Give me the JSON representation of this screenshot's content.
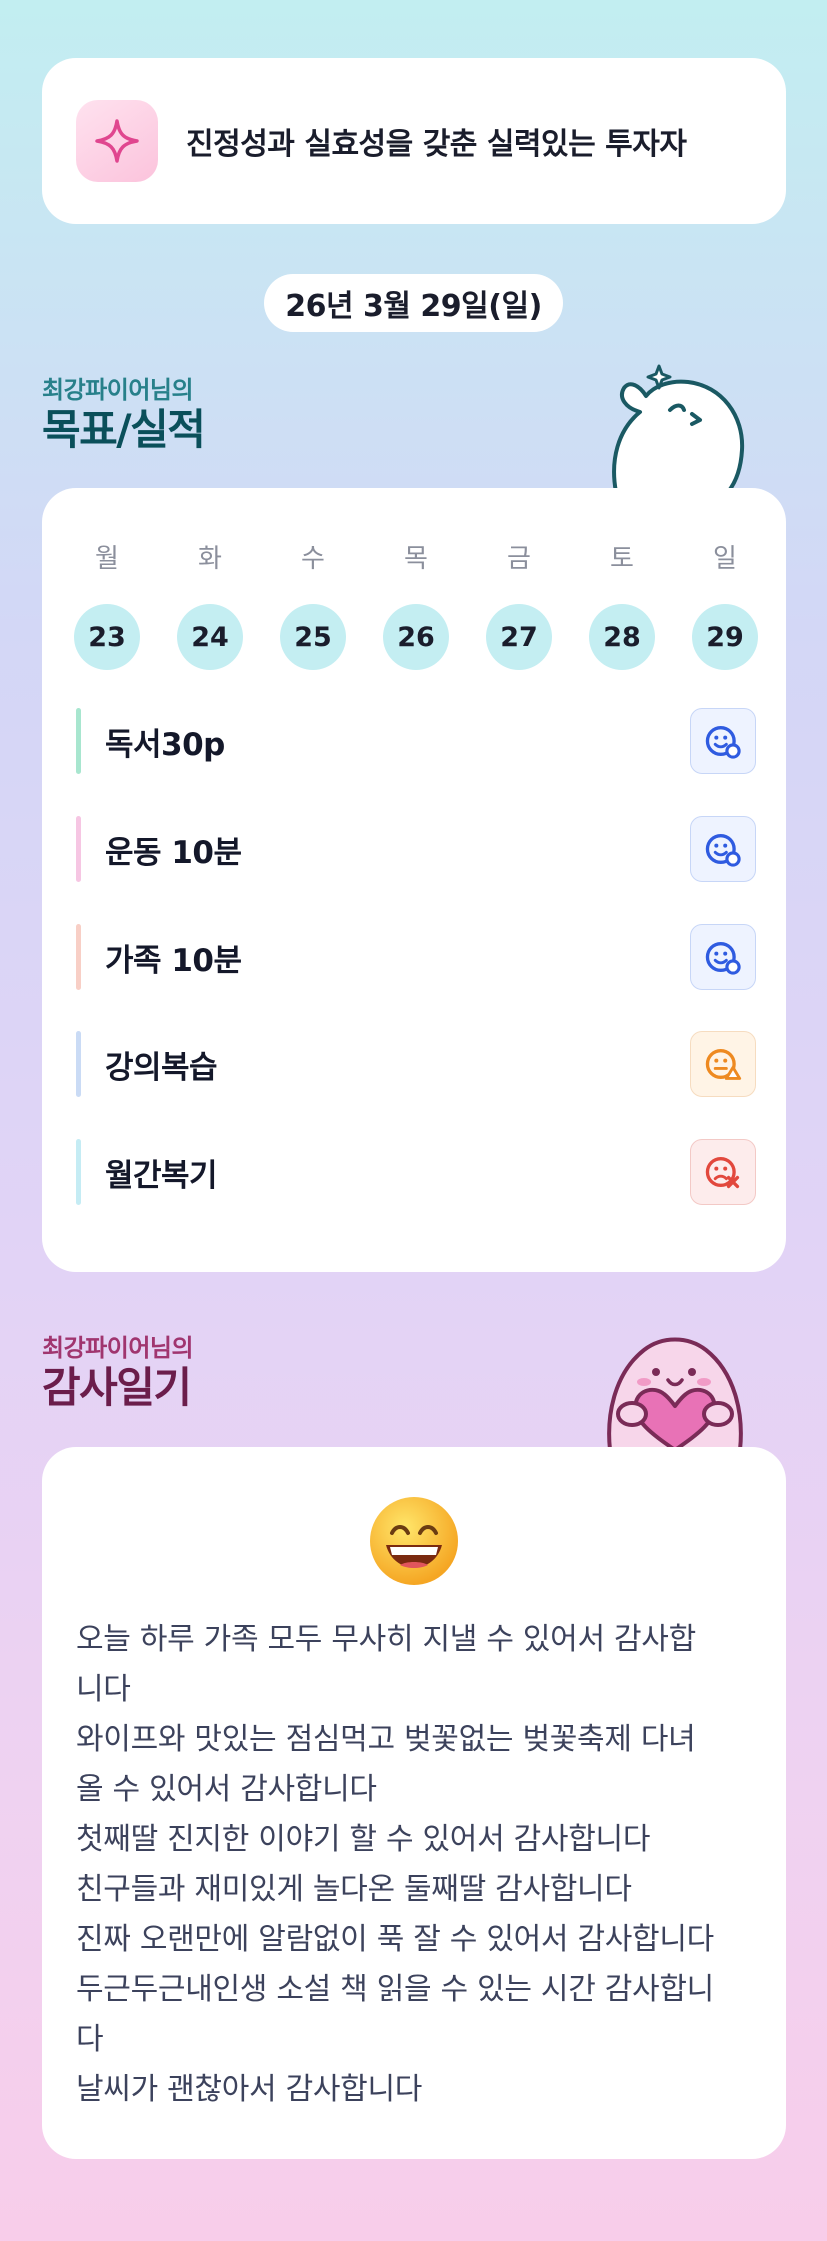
{
  "identity": {
    "icon": "sparkle-icon",
    "text": "진정성과 실효성을 갖춘 실력있는 투자자"
  },
  "date": "26년 3월 29일(일)",
  "goals_section": {
    "subtitle": "최강파이어님의",
    "title": "목표/실적",
    "week": [
      {
        "day": "월",
        "date": "23"
      },
      {
        "day": "화",
        "date": "24"
      },
      {
        "day": "수",
        "date": "25"
      },
      {
        "day": "목",
        "date": "26"
      },
      {
        "day": "금",
        "date": "27"
      },
      {
        "day": "토",
        "date": "28"
      },
      {
        "day": "일",
        "date": "29"
      }
    ],
    "items": [
      {
        "label": "독서30p",
        "bar_color": "#a8e6cf",
        "status": "done",
        "status_icon": "smile-circle-icon"
      },
      {
        "label": "운동 10분",
        "bar_color": "#f6c6e3",
        "status": "done",
        "status_icon": "smile-circle-icon"
      },
      {
        "label": "가족 10분",
        "bar_color": "#f8cfc6",
        "status": "done",
        "status_icon": "smile-circle-icon"
      },
      {
        "label": "강의복습",
        "bar_color": "#cadbf5",
        "status": "partial",
        "status_icon": "meh-triangle-icon"
      },
      {
        "label": "월간복기",
        "bar_color": "#c5ecf4",
        "status": "missed",
        "status_icon": "sad-x-icon"
      }
    ],
    "status_colors": {
      "done": {
        "fg": "#2f5be0",
        "bg": "#eef3ff",
        "border": "#c7d6f7"
      },
      "partial": {
        "fg": "#ee8a21",
        "bg": "#fff4e6",
        "border": "#f6dcc0"
      },
      "missed": {
        "fg": "#e2483d",
        "bg": "#fdecec",
        "border": "#f3c9c6"
      }
    }
  },
  "thanks_section": {
    "subtitle": "최강파이어님의",
    "title": "감사일기",
    "emoji": "grinning-face-icon",
    "lines": [
      "오늘 하루 가족 모두 무사히 지낼 수 있어서 감사합",
      "니다",
      "와이프와 맛있는 점심먹고 벚꽃없는 벚꽃축제 다녀",
      "올 수 있어서 감사합니다",
      "첫째딸 진지한 이야기 할 수 있어서 감사합니다",
      "친구들과 재미있게 놀다온 둘째딸 감사합니다",
      "진짜 오랜만에 알람없이 푹 잘 수 있어서 감사합니다",
      "두근두근내인생 소설 책 읽을 수 있는 시간 감사합니",
      "다",
      "날씨가 괜찮아서 감사합니다"
    ]
  }
}
